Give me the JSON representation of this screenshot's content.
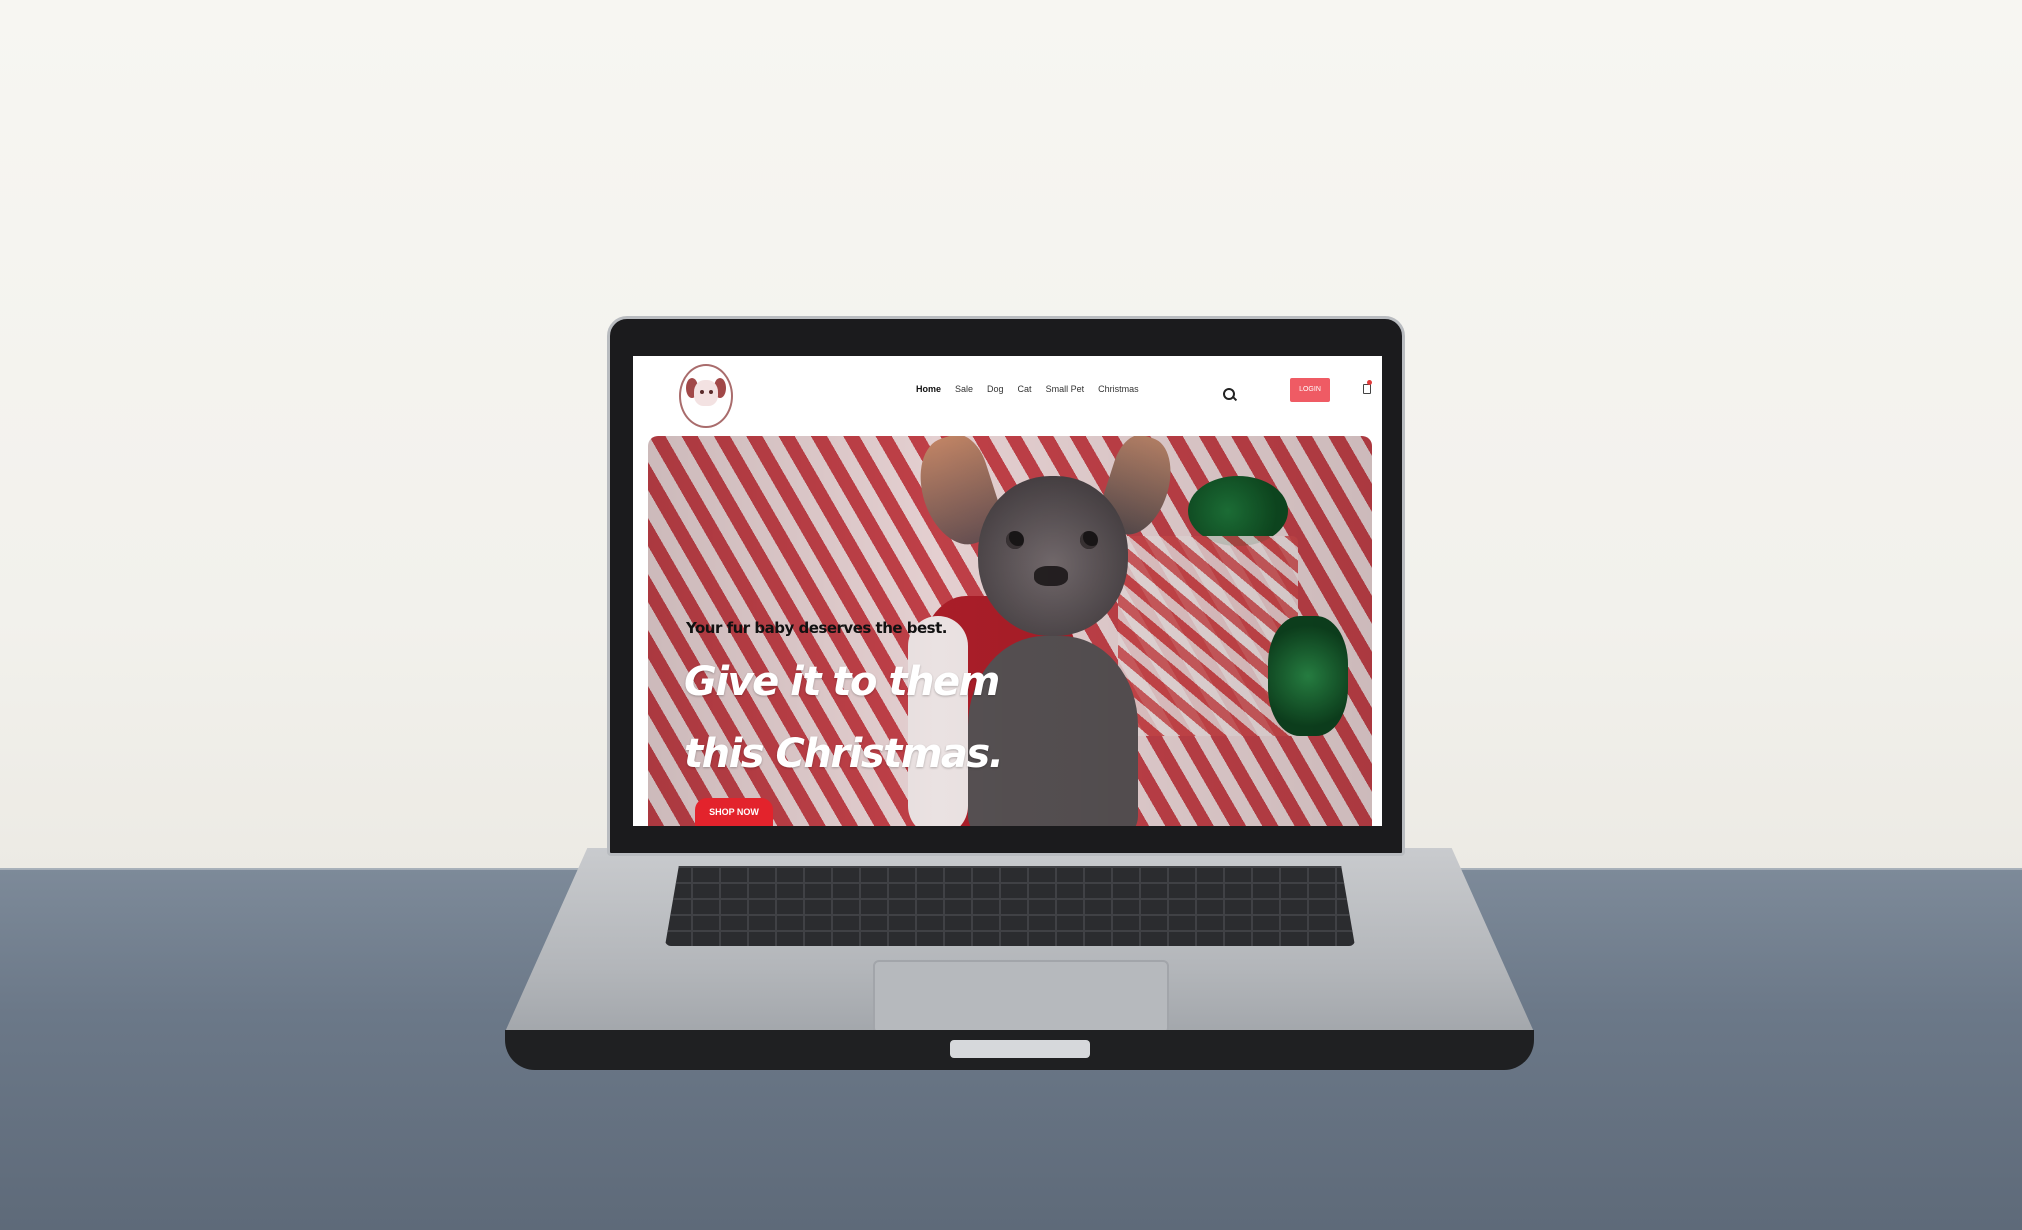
{
  "nav": {
    "menu": [
      "Home",
      "Sale",
      "Dog",
      "Cat",
      "Small Pet",
      "Christmas"
    ],
    "active": "Home",
    "login_label": "LOGIN"
  },
  "hero": {
    "tagline": "Your fur baby deserves the best.",
    "headline": "Give it to them this Christmas.",
    "cta_label": "SHOP NOW"
  },
  "colors": {
    "accent": "#ef5b64",
    "cta": "#e3232c"
  },
  "icons": [
    "logo-dog-icon",
    "search-icon",
    "cart-icon"
  ]
}
